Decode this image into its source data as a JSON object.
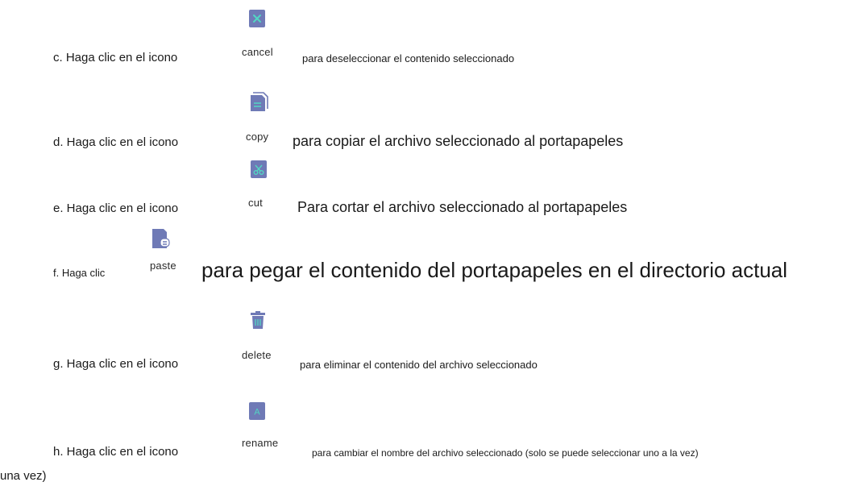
{
  "items": [
    {
      "lead": "c. Haga clic en el icono",
      "icon_name": "cancel-icon",
      "caption": "cancel",
      "desc": "para deseleccionar el contenido seleccionado"
    },
    {
      "lead": "d. Haga clic en el icono",
      "icon_name": "copy-icon",
      "caption": "copy",
      "desc": "para copiar el archivo seleccionado al portapapeles"
    },
    {
      "lead": "e. Haga clic en el icono",
      "icon_name": "cut-icon",
      "caption": "cut",
      "desc": "Para cortar el archivo seleccionado al portapapeles"
    },
    {
      "lead": "f. Haga clic",
      "icon_name": "paste-icon",
      "caption": "paste",
      "desc": "para pegar el contenido del portapapeles en el directorio actual"
    },
    {
      "lead": "g. Haga clic en el icono",
      "icon_name": "delete-icon",
      "caption": "delete",
      "desc": "para eliminar el contenido del archivo seleccionado"
    },
    {
      "lead": "h. Haga clic en el icono",
      "icon_name": "rename-icon",
      "caption": "rename",
      "desc": "para cambiar el nombre del archivo seleccionado (solo se puede seleccionar uno a la vez)"
    }
  ],
  "continuation": "una vez)",
  "colors": {
    "icon_fill": "#6f7ab6",
    "icon_glyph": "#52d6c3",
    "text": "#1a1a1a"
  }
}
